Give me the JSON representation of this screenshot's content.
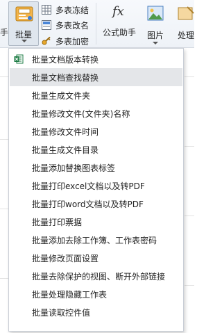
{
  "ribbon": {
    "left_edge_label": "手",
    "batch_button": {
      "label": "批量",
      "icon": "batch-doc-icon"
    },
    "small_commands": [
      {
        "label": "多表冻结",
        "icon": "freeze-grid-icon"
      },
      {
        "label": "多表改名",
        "icon": "rename-sheet-icon"
      },
      {
        "label": "多表加密",
        "icon": "key-icon"
      }
    ],
    "formula_button": {
      "label": "公式助手",
      "icon": "fx-icon",
      "glyph": "fx"
    },
    "picture_button": {
      "label": "图片",
      "icon": "picture-icon"
    },
    "process_button": {
      "label": "处理",
      "icon": "process-icon"
    }
  },
  "menu": {
    "items": [
      {
        "label": "批量文档版本转换",
        "icon": "excel-convert-icon"
      },
      {
        "label": "批量文档查找替换",
        "highlighted": true
      },
      {
        "label": "批量生成文件夹"
      },
      {
        "label": "批量修改文件(文件夹)名称"
      },
      {
        "label": "批量修改文件时间"
      },
      {
        "label": "批量生成文件目录"
      },
      {
        "label": "批量添加替换图表标签"
      },
      {
        "label": "批量打印excel文档以及转PDF"
      },
      {
        "label": "批量打印word文档以及转PDF"
      },
      {
        "label": "批量打印票据"
      },
      {
        "label": "批量添加去除工作簿、工作表密码"
      },
      {
        "label": "批量修改页面设置"
      },
      {
        "label": "批量去除保护的视图、断开外部链接"
      },
      {
        "label": "批量处理隐藏工作表"
      },
      {
        "label": "批量读取控件值"
      }
    ]
  },
  "colors": {
    "menu_highlight": "#e4e6e9",
    "ribbon_bg": "#eef2f7",
    "excel_green": "#1e7c45"
  }
}
